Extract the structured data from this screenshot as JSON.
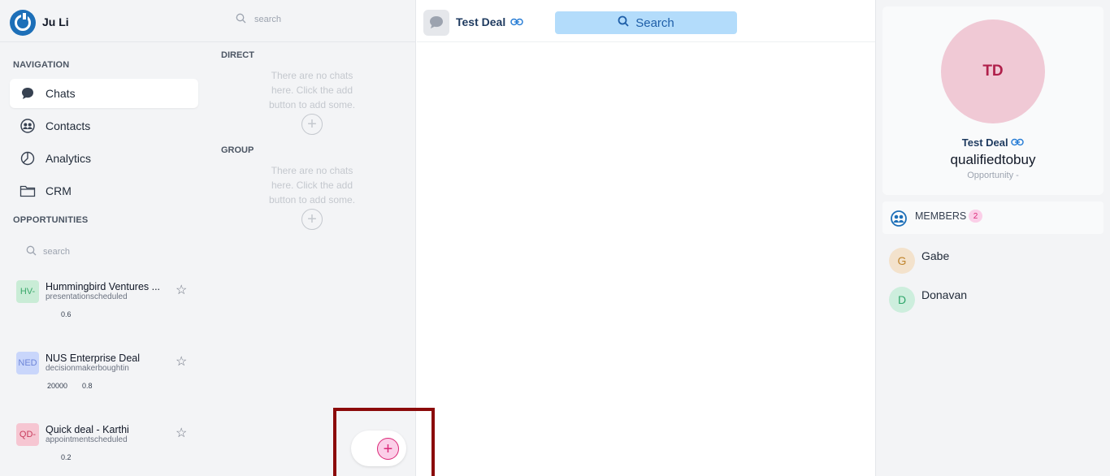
{
  "user": {
    "name": "Ju Li"
  },
  "navigation": {
    "section_label": "NAVIGATION",
    "items": [
      {
        "label": "Chats",
        "icon": "chat-bubble-icon",
        "active": true
      },
      {
        "label": "Contacts",
        "icon": "contacts-icon",
        "active": false
      },
      {
        "label": "Analytics",
        "icon": "analytics-pie-icon",
        "active": false
      },
      {
        "label": "CRM",
        "icon": "folder-icon",
        "active": false
      }
    ]
  },
  "opportunities": {
    "section_label": "OPPORTUNITIES",
    "search_placeholder": "search",
    "items": [
      {
        "badge": "HV-",
        "badge_bg": "#c9ecd6",
        "badge_color": "#3aa86b",
        "title": "Hummingbird Ventures ...",
        "stage": "presentationscheduled",
        "metric_a": "",
        "metric_b": "0.6"
      },
      {
        "badge": "NED",
        "badge_bg": "#c9d6fb",
        "badge_color": "#6d85d8",
        "title": "NUS Enterprise Deal",
        "stage": "decisionmakerboughtin",
        "metric_a": "20000",
        "metric_b": "0.8"
      },
      {
        "badge": "QD-",
        "badge_bg": "#f6c6d2",
        "badge_color": "#c83a5c",
        "title": "Quick deal - Karthi",
        "stage": "appointmentscheduled",
        "metric_a": "",
        "metric_b": "0.2"
      }
    ]
  },
  "chats": {
    "search_placeholder": "search",
    "direct_label": "DIRECT",
    "direct_empty": "There are no chats here. Click the add button to add some.",
    "group_label": "GROUP",
    "group_empty": "There are no chats here. Click the add button to add some."
  },
  "main": {
    "deal_title": "Test Deal",
    "search_button": "Search"
  },
  "profile": {
    "initials": "TD",
    "name": "Test Deal",
    "stage": "qualifiedtobuy",
    "type": "Opportunity -"
  },
  "members": {
    "label": "MEMBERS",
    "count": "2",
    "items": [
      {
        "initial": "G",
        "name": "Gabe",
        "bg": "#f3e2cc",
        "color": "#c0842c"
      },
      {
        "initial": "D",
        "name": "Donavan",
        "bg": "#cdeedd",
        "color": "#2fa66a"
      }
    ]
  },
  "colors": {
    "accent": "#1d6fb8",
    "pink_accent": "#db2777",
    "search_bg": "#b3dcfb"
  }
}
